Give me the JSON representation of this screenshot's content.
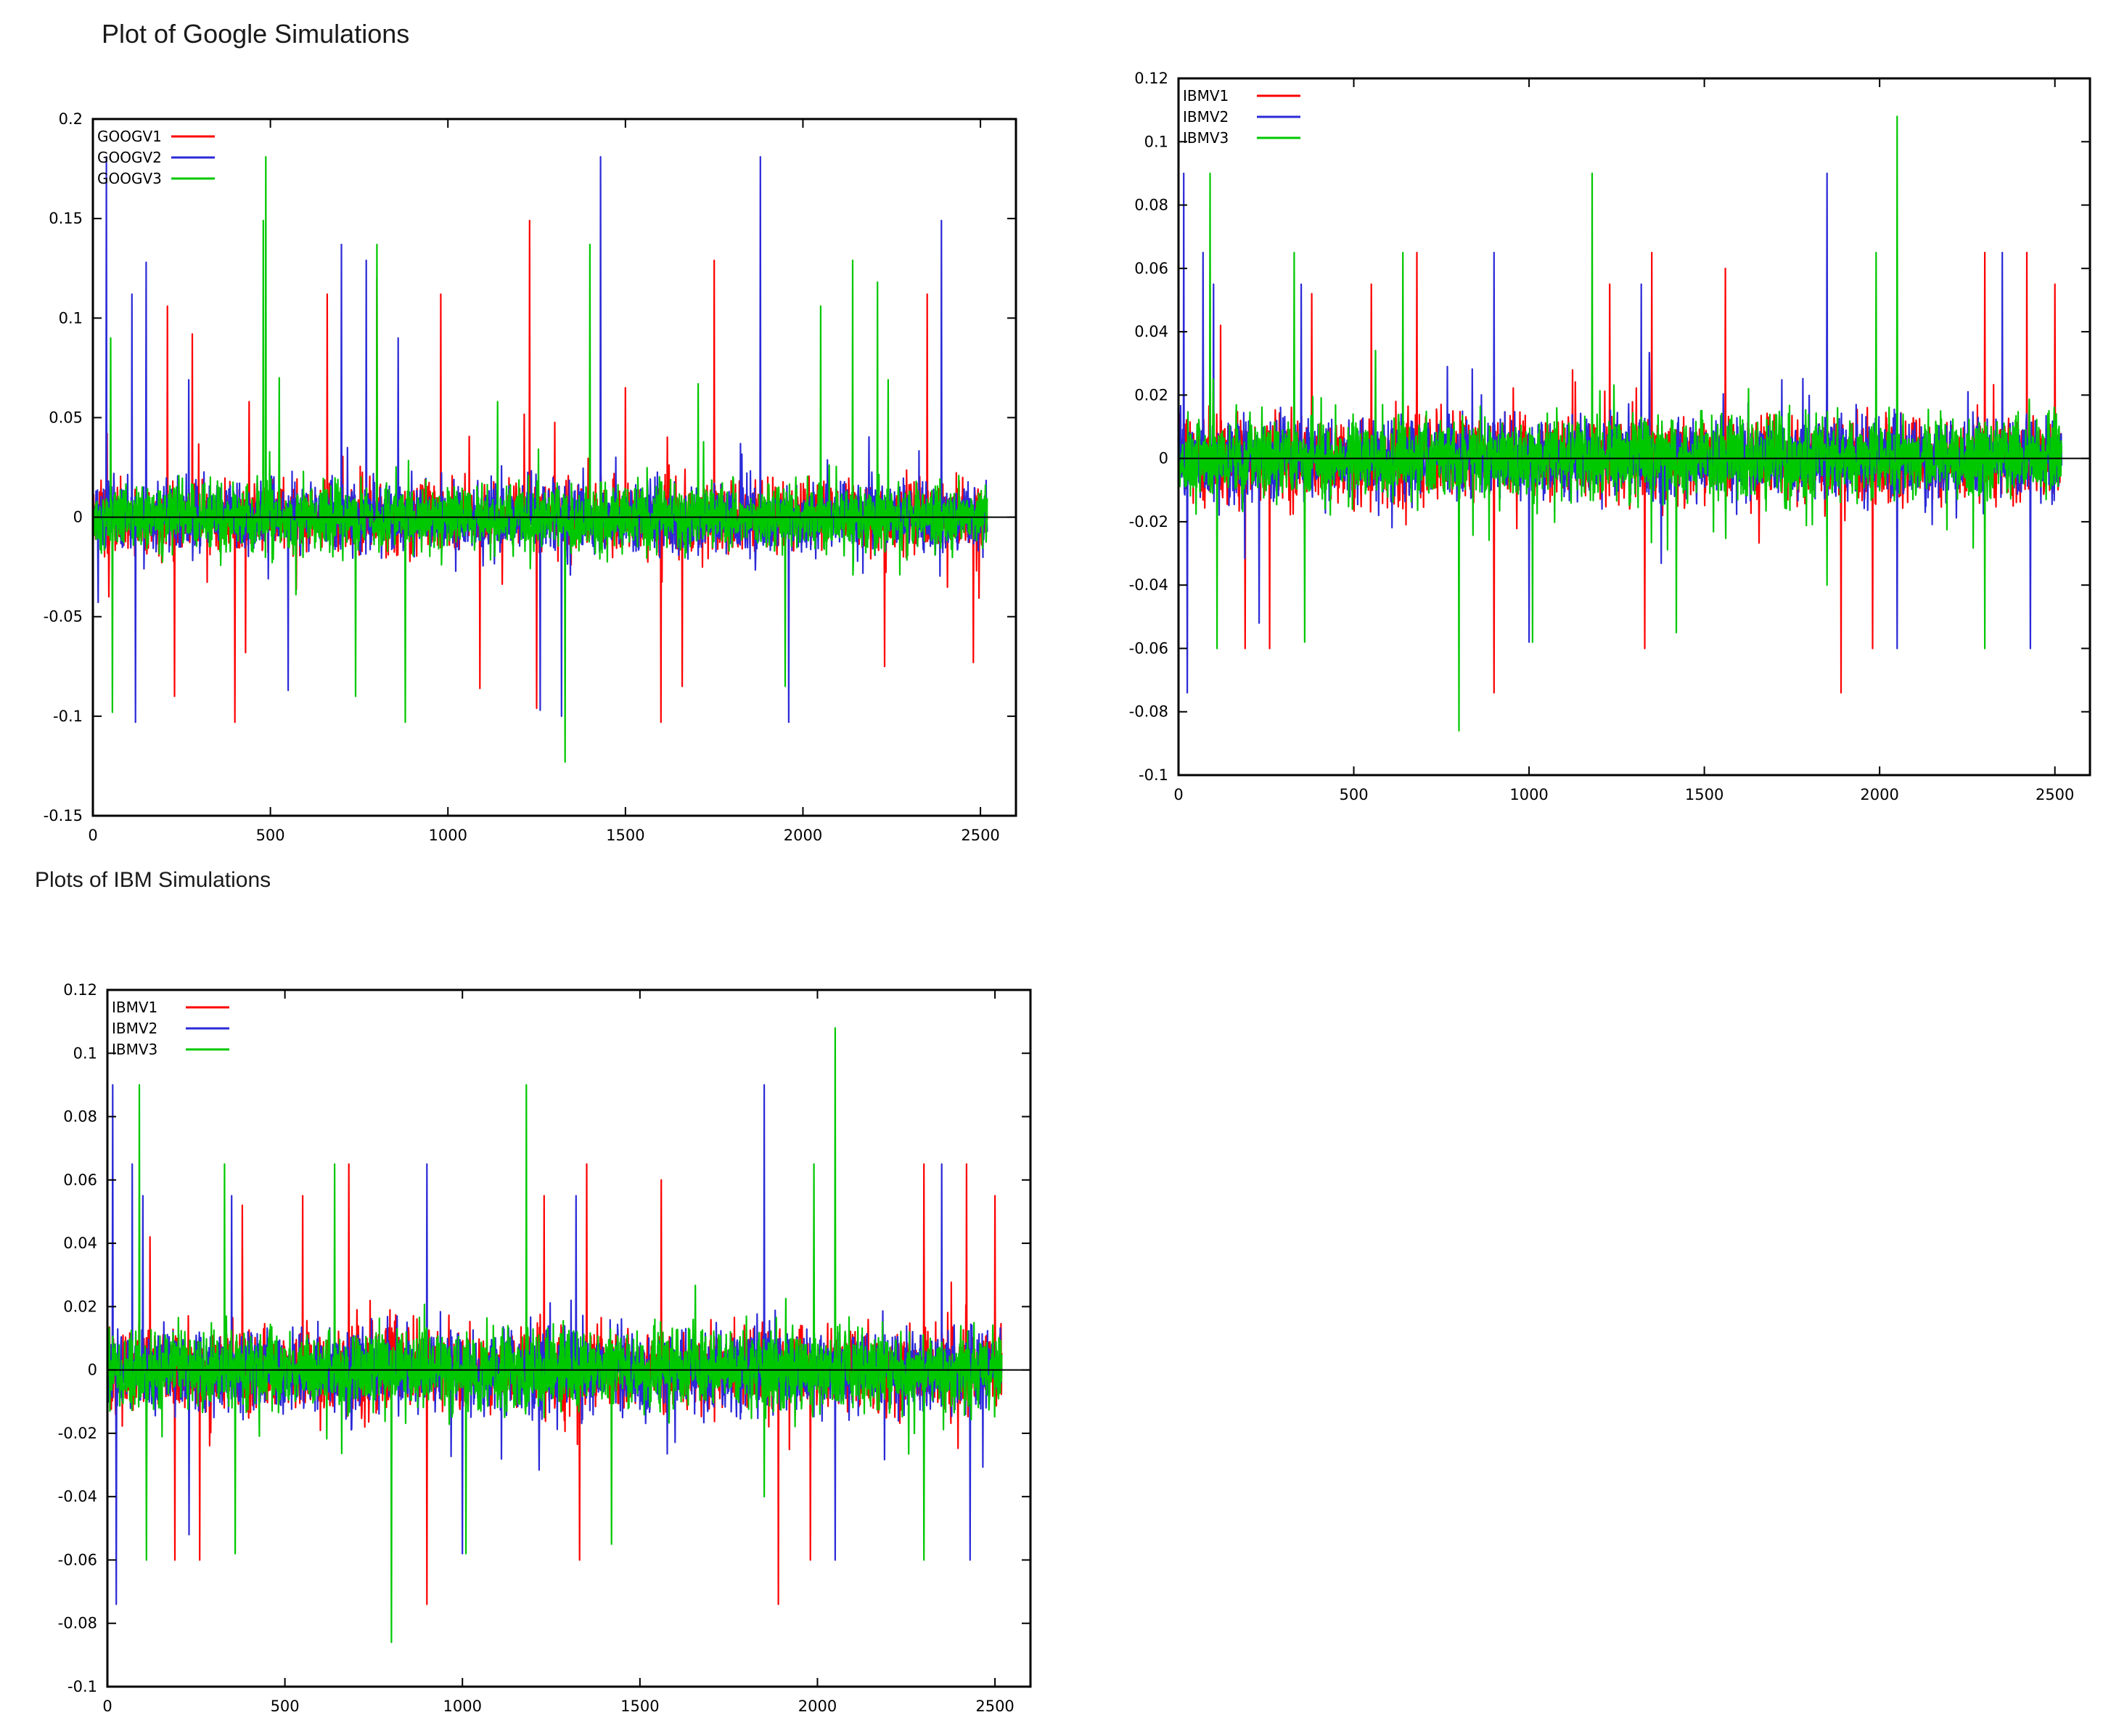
{
  "page": {
    "heading_google": "Plot of Google Simulations",
    "heading_ibm": "Plots of IBM Simulations"
  },
  "colors": {
    "V1": "#ff0000",
    "V2": "#2a2ad8",
    "V3": "#00c800",
    "frame": "#000000"
  },
  "chart_data": [
    {
      "id": "google",
      "type": "line",
      "title": "",
      "xlabel": "",
      "ylabel": "",
      "xlim": [
        0,
        2600
      ],
      "ylim": [
        -0.15,
        0.2
      ],
      "xticks": [
        0,
        500,
        1000,
        1500,
        2000,
        2500
      ],
      "xtick_labels": [
        "0",
        "500",
        "1000",
        "1500",
        "2000",
        "2500"
      ],
      "yticks": [
        -0.15,
        -0.1,
        -0.05,
        0,
        0.05,
        0.1,
        0.15,
        0.2
      ],
      "ytick_labels": [
        "-0.15",
        "-0.1",
        "-0.05",
        "0",
        "0.05",
        "0.1",
        "0.15",
        "0.2"
      ],
      "grid": false,
      "zero_line": true,
      "legend_position": "top-left",
      "n_points": 2520,
      "base_sd": 0.0115,
      "series": [
        {
          "name": "GOOGV1",
          "color": "#ff0000",
          "spikes": [
            [
              40,
              0.042
            ],
            [
              45,
              -0.04
            ],
            [
              210,
              0.106
            ],
            [
              230,
              -0.09
            ],
            [
              280,
              0.092
            ],
            [
              400,
              -0.103
            ],
            [
              430,
              -0.068
            ],
            [
              440,
              0.058
            ],
            [
              660,
              0.112
            ],
            [
              800,
              0.12
            ],
            [
              980,
              0.112
            ],
            [
              1090,
              -0.086
            ],
            [
              1230,
              0.149
            ],
            [
              1250,
              -0.096
            ],
            [
              1500,
              0.065
            ],
            [
              1600,
              -0.103
            ],
            [
              1660,
              -0.085
            ],
            [
              1750,
              0.129
            ],
            [
              2230,
              -0.075
            ],
            [
              2350,
              0.112
            ],
            [
              2480,
              -0.073
            ]
          ]
        },
        {
          "name": "GOOGV2",
          "color": "#2a2ad8",
          "spikes": [
            [
              38,
              0.181
            ],
            [
              120,
              -0.103
            ],
            [
              150,
              0.128
            ],
            [
              110,
              0.112
            ],
            [
              270,
              0.069
            ],
            [
              550,
              -0.087
            ],
            [
              700,
              0.137
            ],
            [
              770,
              0.129
            ],
            [
              860,
              0.09
            ],
            [
              1260,
              -0.097
            ],
            [
              1320,
              -0.1
            ],
            [
              1430,
              0.181
            ],
            [
              1880,
              0.181
            ],
            [
              1960,
              -0.103
            ],
            [
              2390,
              0.149
            ]
          ]
        },
        {
          "name": "GOOGV3",
          "color": "#00c800",
          "spikes": [
            [
              50,
              0.09
            ],
            [
              55,
              -0.098
            ],
            [
              480,
              0.149
            ],
            [
              487,
              0.181
            ],
            [
              525,
              0.07
            ],
            [
              740,
              -0.09
            ],
            [
              800,
              0.137
            ],
            [
              880,
              -0.103
            ],
            [
              1140,
              0.058
            ],
            [
              1330,
              -0.123
            ],
            [
              1400,
              0.137
            ],
            [
              1705,
              0.067
            ],
            [
              1950,
              -0.085
            ],
            [
              2050,
              0.106
            ],
            [
              2140,
              0.129
            ],
            [
              2210,
              0.118
            ],
            [
              2240,
              0.069
            ]
          ]
        }
      ]
    },
    {
      "id": "ibm_top",
      "type": "line",
      "title": "",
      "xlabel": "",
      "ylabel": "",
      "xlim": [
        0,
        2600
      ],
      "ylim": [
        -0.1,
        0.12
      ],
      "xticks": [
        0,
        500,
        1000,
        1500,
        2000,
        2500
      ],
      "xtick_labels": [
        "0",
        "500",
        "1000",
        "1500",
        "2000",
        "2500"
      ],
      "yticks": [
        -0.1,
        -0.08,
        -0.06,
        -0.04,
        -0.02,
        0,
        0.02,
        0.04,
        0.06,
        0.08,
        0.1,
        0.12
      ],
      "ytick_labels": [
        "-0.1",
        "-0.08",
        "-0.06",
        "-0.04",
        "-0.02",
        "0",
        "0.02",
        "0.04",
        "0.06",
        "0.08",
        "0.1",
        "0.12"
      ],
      "grid": false,
      "zero_line": true,
      "legend_position": "top-left",
      "n_points": 2520,
      "base_sd": 0.0085,
      "series": [
        {
          "name": "IBMV1",
          "color": "#ff0000",
          "spikes": [
            [
              120,
              0.042
            ],
            [
              190,
              -0.06
            ],
            [
              260,
              -0.06
            ],
            [
              380,
              0.052
            ],
            [
              550,
              0.055
            ],
            [
              680,
              0.065
            ],
            [
              900,
              -0.074
            ],
            [
              1230,
              0.055
            ],
            [
              1330,
              -0.06
            ],
            [
              1350,
              0.065
            ],
            [
              1560,
              0.06
            ],
            [
              1890,
              -0.074
            ],
            [
              1980,
              -0.06
            ],
            [
              2300,
              0.065
            ],
            [
              2420,
              0.065
            ],
            [
              2500,
              0.055
            ]
          ]
        },
        {
          "name": "IBMV2",
          "color": "#2a2ad8",
          "spikes": [
            [
              15,
              0.09
            ],
            [
              25,
              -0.074
            ],
            [
              70,
              0.065
            ],
            [
              100,
              0.055
            ],
            [
              230,
              -0.052
            ],
            [
              350,
              0.055
            ],
            [
              900,
              0.065
            ],
            [
              1000,
              -0.058
            ],
            [
              1320,
              0.055
            ],
            [
              1850,
              0.09
            ],
            [
              2050,
              -0.06
            ],
            [
              2350,
              0.065
            ],
            [
              2430,
              -0.06
            ]
          ]
        },
        {
          "name": "IBMV3",
          "color": "#00c800",
          "spikes": [
            [
              90,
              0.09
            ],
            [
              110,
              -0.06
            ],
            [
              330,
              0.065
            ],
            [
              360,
              -0.058
            ],
            [
              640,
              0.065
            ],
            [
              800,
              -0.086
            ],
            [
              1010,
              -0.058
            ],
            [
              1180,
              0.09
            ],
            [
              1420,
              -0.055
            ],
            [
              1850,
              -0.04
            ],
            [
              1990,
              0.065
            ],
            [
              2050,
              0.108
            ],
            [
              2300,
              -0.06
            ]
          ]
        }
      ]
    },
    {
      "id": "ibm_bottom",
      "type": "line",
      "title": "",
      "xlabel": "",
      "ylabel": "",
      "xlim": [
        0,
        2600
      ],
      "ylim": [
        -0.1,
        0.12
      ],
      "xticks": [
        0,
        500,
        1000,
        1500,
        2000,
        2500
      ],
      "xtick_labels": [
        "0",
        "500",
        "1000",
        "1500",
        "2000",
        "2500"
      ],
      "yticks": [
        -0.1,
        -0.08,
        -0.06,
        -0.04,
        -0.02,
        0,
        0.02,
        0.04,
        0.06,
        0.08,
        0.1,
        0.12
      ],
      "ytick_labels": [
        "-0.1",
        "-0.08",
        "-0.06",
        "-0.04",
        "-0.02",
        "0",
        "0.02",
        "0.04",
        "0.06",
        "0.08",
        "0.1",
        "0.12"
      ],
      "grid": false,
      "zero_line": true,
      "legend_position": "top-left",
      "n_points": 2520,
      "base_sd": 0.0085,
      "series": [
        {
          "name": "IBMV1",
          "color": "#ff0000",
          "spikes": [
            [
              120,
              0.042
            ],
            [
              190,
              -0.06
            ],
            [
              260,
              -0.06
            ],
            [
              380,
              0.052
            ],
            [
              550,
              0.055
            ],
            [
              680,
              0.065
            ],
            [
              900,
              -0.074
            ],
            [
              1230,
              0.055
            ],
            [
              1330,
              -0.06
            ],
            [
              1350,
              0.065
            ],
            [
              1560,
              0.06
            ],
            [
              1890,
              -0.074
            ],
            [
              1980,
              -0.06
            ],
            [
              2300,
              0.065
            ],
            [
              2420,
              0.065
            ],
            [
              2500,
              0.055
            ]
          ]
        },
        {
          "name": "IBMV2",
          "color": "#2a2ad8",
          "spikes": [
            [
              15,
              0.09
            ],
            [
              25,
              -0.074
            ],
            [
              70,
              0.065
            ],
            [
              100,
              0.055
            ],
            [
              230,
              -0.052
            ],
            [
              350,
              0.055
            ],
            [
              900,
              0.065
            ],
            [
              1000,
              -0.058
            ],
            [
              1320,
              0.055
            ],
            [
              1850,
              0.09
            ],
            [
              2050,
              -0.06
            ],
            [
              2350,
              0.065
            ],
            [
              2430,
              -0.06
            ]
          ]
        },
        {
          "name": "IBMV3",
          "color": "#00c800",
          "spikes": [
            [
              90,
              0.09
            ],
            [
              110,
              -0.06
            ],
            [
              330,
              0.065
            ],
            [
              360,
              -0.058
            ],
            [
              640,
              0.065
            ],
            [
              800,
              -0.086
            ],
            [
              1010,
              -0.058
            ],
            [
              1180,
              0.09
            ],
            [
              1420,
              -0.055
            ],
            [
              1850,
              -0.04
            ],
            [
              1990,
              0.065
            ],
            [
              2050,
              0.108
            ],
            [
              2300,
              -0.06
            ]
          ]
        }
      ]
    }
  ]
}
